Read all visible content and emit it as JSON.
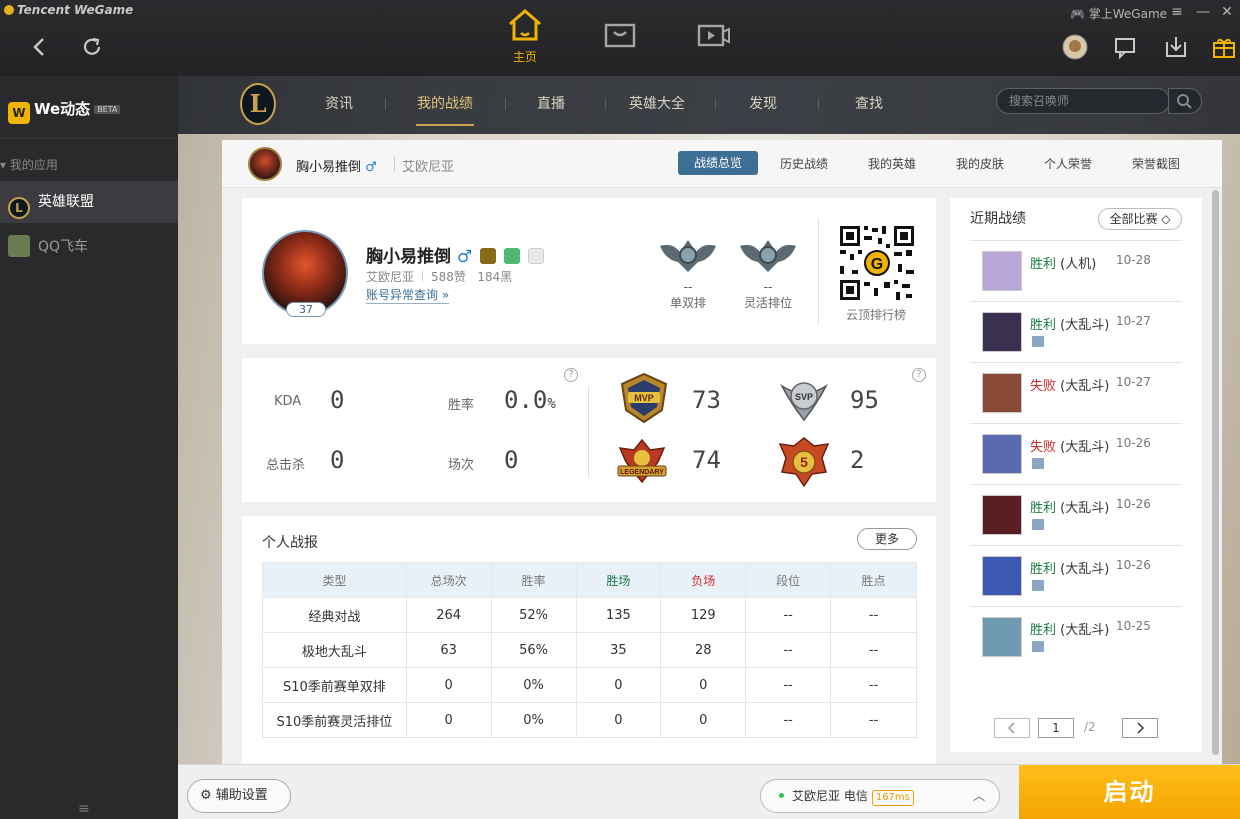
{
  "colors": {
    "accent": "#f0b400",
    "nav_active": "#e0c27a",
    "win": "#1c7a46",
    "lose": "#d12a2a",
    "tab_active": "#3d6f94"
  },
  "app": {
    "brand": "Tencent WeGame",
    "home_label": "主页",
    "mobile_label": "掌上WeGame",
    "back_icon": "arrow-left-icon",
    "refresh_icon": "refresh-icon"
  },
  "sidebar": {
    "we_title": "We动态",
    "we_badge": "BETA",
    "section_label": "我的应用",
    "apps": [
      {
        "label": "英雄联盟",
        "icon": "lol-icon",
        "active": true
      },
      {
        "label": "QQ飞车",
        "icon": "qqspeed-icon",
        "active": false
      }
    ],
    "menu_icon": "≡"
  },
  "lolnav": {
    "items": [
      "资讯",
      "我的战绩",
      "直播",
      "英雄大全",
      "发现",
      "查找"
    ],
    "active": "我的战绩",
    "search_placeholder": "搜索召唤师"
  },
  "subheader": {
    "name": "胸小易推倒",
    "gender": "♂",
    "server": "艾欧尼亚",
    "tabs": [
      "战绩总览",
      "历史战绩",
      "我的英雄",
      "我的皮肤",
      "个人荣誉",
      "荣誉截图"
    ]
  },
  "profile": {
    "name": "胸小易推倒",
    "gender": "♂",
    "level": "37",
    "server": "艾欧尼亚",
    "likes": "588赞",
    "blacks": "184黑",
    "anomaly_link": "账号异常查询 »",
    "ranks": [
      {
        "value": "--",
        "label": "单双排"
      },
      {
        "value": "--",
        "label": "灵活排位"
      }
    ],
    "qr_label": "云顶排行榜"
  },
  "stats": {
    "kda_label": "KDA",
    "kda": "0",
    "winrate_label": "胜率",
    "winrate": "0.0",
    "winrate_unit": "%",
    "kills_label": "总击杀",
    "kills": "0",
    "games_label": "场次",
    "games": "0",
    "honors": [
      {
        "badge": "MVP",
        "value": "73"
      },
      {
        "badge": "SVP",
        "value": "95"
      },
      {
        "badge": "LEGENDARY",
        "value": "74"
      },
      {
        "badge": "5",
        "value": "2"
      }
    ]
  },
  "report": {
    "title": "个人战报",
    "more": "更多",
    "headers": [
      "类型",
      "总场次",
      "胜率",
      "胜场",
      "负场",
      "段位",
      "胜点"
    ],
    "rows": [
      [
        "经典对战",
        "264",
        "52%",
        "135",
        "129",
        "--",
        "--"
      ],
      [
        "极地大乱斗",
        "63",
        "56%",
        "35",
        "28",
        "--",
        "--"
      ],
      [
        "S10季前赛单双排",
        "0",
        "0%",
        "0",
        "0",
        "--",
        "--"
      ],
      [
        "S10季前赛灵活排位",
        "0",
        "0%",
        "0",
        "0",
        "--",
        "--"
      ]
    ]
  },
  "recent": {
    "title": "近期战绩",
    "filter": "全部比赛 ◇",
    "matches": [
      {
        "result": "胜利",
        "mode": "(人机)",
        "date": "10-28",
        "win": true,
        "hero_color": "#b9a6d8",
        "screenshot": false
      },
      {
        "result": "胜利",
        "mode": "(大乱斗)",
        "date": "10-27",
        "win": true,
        "hero_color": "#3a3050",
        "screenshot": true
      },
      {
        "result": "失败",
        "mode": "(大乱斗)",
        "date": "10-27",
        "win": false,
        "hero_color": "#8a4a38",
        "screenshot": false
      },
      {
        "result": "失败",
        "mode": "(大乱斗)",
        "date": "10-26",
        "win": false,
        "hero_color": "#5a6ab0",
        "screenshot": true
      },
      {
        "result": "胜利",
        "mode": "(大乱斗)",
        "date": "10-26",
        "win": true,
        "hero_color": "#5a1f22",
        "screenshot": true
      },
      {
        "result": "胜利",
        "mode": "(大乱斗)",
        "date": "10-26",
        "win": true,
        "hero_color": "#3c58b0",
        "screenshot": true
      },
      {
        "result": "胜利",
        "mode": "(大乱斗)",
        "date": "10-25",
        "win": true,
        "hero_color": "#6f9ab0",
        "screenshot": true
      }
    ],
    "page_current": "1",
    "page_total": "/2"
  },
  "bottom": {
    "assist": "辅助设置",
    "server": "艾欧尼亚 电信",
    "ping": "167ms",
    "launch": "启动"
  }
}
